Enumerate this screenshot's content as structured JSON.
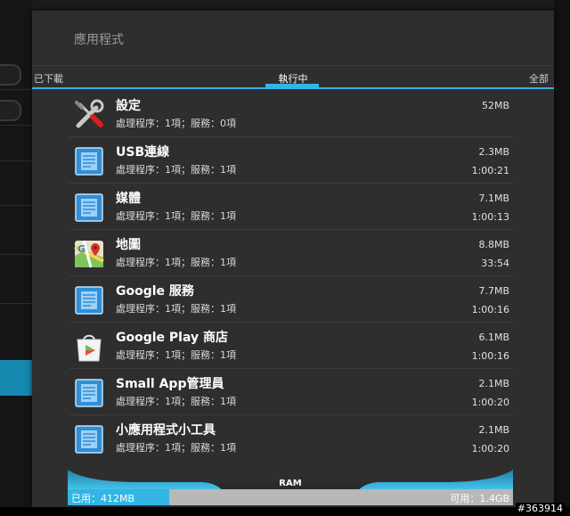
{
  "dialog": {
    "title": "應用程式",
    "tabs": {
      "left": "已下載",
      "active": "執行中",
      "right": "全部"
    }
  },
  "apps": [
    {
      "name": "設定",
      "detail": "處理程序：1項；服務：0項",
      "size": "52MB",
      "time": "",
      "icon": "settings-tools-icon"
    },
    {
      "name": "USB連線",
      "detail": "處理程序：1項；服務：1項",
      "size": "2.3MB",
      "time": "1:00:21",
      "icon": "generic-app-icon"
    },
    {
      "name": "媒體",
      "detail": "處理程序：1項；服務：1項",
      "size": "7.1MB",
      "time": "1:00:13",
      "icon": "generic-app-icon"
    },
    {
      "name": "地圖",
      "detail": "處理程序：1項；服務：1項",
      "size": "8.8MB",
      "time": "33:54",
      "icon": "maps-icon"
    },
    {
      "name": "Google 服務",
      "detail": "處理程序：1項；服務：1項",
      "size": "7.7MB",
      "time": "1:00:16",
      "icon": "generic-app-icon"
    },
    {
      "name": "Google Play 商店",
      "detail": "處理程序：1項；服務：1項",
      "size": "6.1MB",
      "time": "1:00:16",
      "icon": "play-store-icon"
    },
    {
      "name": "Small App管理員",
      "detail": "處理程序：1項；服務：1項",
      "size": "2.1MB",
      "time": "1:00:20",
      "icon": "generic-app-icon"
    },
    {
      "name": "小應用程式小工具",
      "detail": "處理程序：1項；服務：1項",
      "size": "2.1MB",
      "time": "1:00:20",
      "icon": "generic-app-icon"
    }
  ],
  "ram": {
    "label": "RAM",
    "used": "已用：412MB",
    "free": "可用：1.4GB",
    "used_fraction": 0.227
  },
  "watermark": "#363914",
  "colors": {
    "accent": "#33b5e5",
    "dialog_bg": "#2e2e2e"
  }
}
